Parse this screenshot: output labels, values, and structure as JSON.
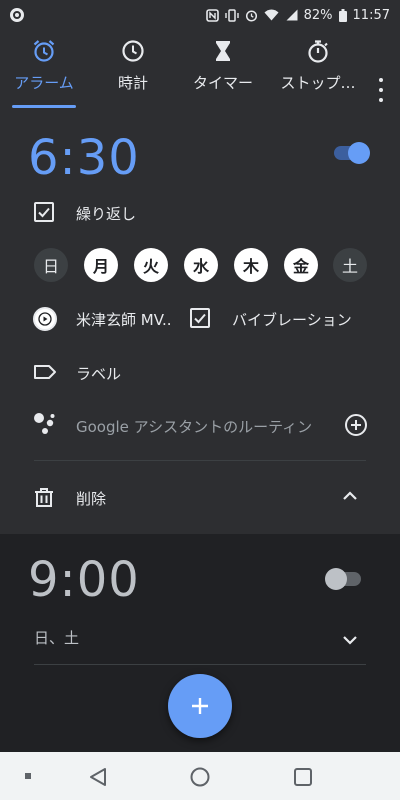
{
  "status_bar": {
    "battery": "82%",
    "time": "11:57"
  },
  "tabs": [
    {
      "label": "アラーム",
      "icon": "alarm-icon",
      "active": true
    },
    {
      "label": "時計",
      "icon": "clock-icon",
      "active": false
    },
    {
      "label": "タイマー",
      "icon": "hourglass-icon",
      "active": false
    },
    {
      "label": "ストップ…",
      "icon": "stopwatch-icon",
      "active": false
    }
  ],
  "colors": {
    "accent": "#669df6",
    "background": "#202124",
    "card": "#2d2e31"
  },
  "alarm1": {
    "time": "6:30",
    "enabled": true,
    "repeat_label": "繰り返し",
    "repeat_checked": true,
    "days": [
      {
        "label": "日",
        "selected": false
      },
      {
        "label": "月",
        "selected": true
      },
      {
        "label": "火",
        "selected": true
      },
      {
        "label": "水",
        "selected": true
      },
      {
        "label": "木",
        "selected": true
      },
      {
        "label": "金",
        "selected": true
      },
      {
        "label": "土",
        "selected": false
      }
    ],
    "ringtone": "米津玄師 MV..",
    "vibration_label": "バイブレーション",
    "vibration_checked": true,
    "label_text": "ラベル",
    "assistant_text": "Google アシスタントのルーティン",
    "delete_label": "削除"
  },
  "alarm2": {
    "time": "9:00",
    "enabled": false,
    "days_summary": "日、土"
  }
}
